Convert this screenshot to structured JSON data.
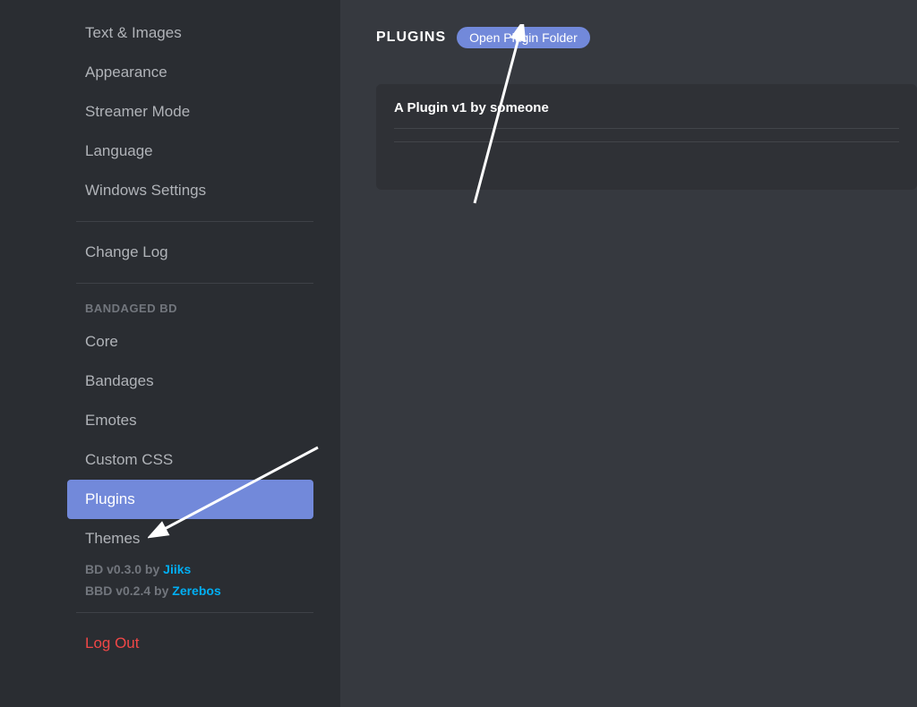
{
  "sidebar": {
    "app_settings": [
      "Text & Images",
      "Appearance",
      "Streamer Mode",
      "Language",
      "Windows Settings"
    ],
    "change_log": "Change Log",
    "bd_header": "BANDAGED BD",
    "bd_items": [
      "Core",
      "Bandages",
      "Emotes",
      "Custom CSS",
      "Plugins",
      "Themes"
    ],
    "credits": {
      "bd_prefix": "BD v0.3.0 by ",
      "bd_author": "Jiiks",
      "bbd_prefix": "BBD v0.2.4 by ",
      "bbd_author": "Zerebos"
    },
    "logout": "Log Out"
  },
  "main": {
    "title": "PLUGINS",
    "folder_button": "Open Plugin Folder",
    "plugin": {
      "title": "A Plugin v1 by someone"
    }
  }
}
